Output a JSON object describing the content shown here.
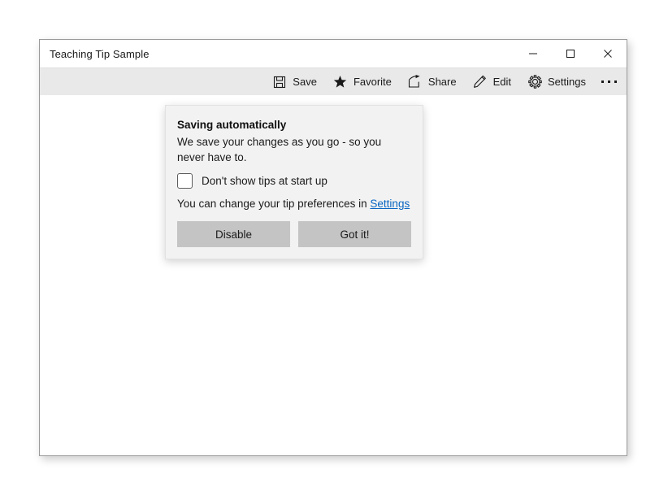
{
  "window": {
    "title": "Teaching Tip Sample",
    "controls": [
      {
        "name": "minimize-button",
        "icon": "minimize-icon"
      },
      {
        "name": "maximize-button",
        "icon": "maximize-icon"
      },
      {
        "name": "close-button",
        "icon": "close-icon"
      }
    ]
  },
  "command_bar": {
    "items": [
      {
        "label": "Save",
        "icon": "save-icon"
      },
      {
        "label": "Favorite",
        "icon": "star-icon"
      },
      {
        "label": "Share",
        "icon": "share-icon"
      },
      {
        "label": "Edit",
        "icon": "pencil-icon"
      },
      {
        "label": "Settings",
        "icon": "gear-icon"
      }
    ],
    "overflow_label": "· · ·"
  },
  "teaching_tip": {
    "title": "Saving automatically",
    "subtitle": "We save your changes as you go - so you never have to.",
    "checkbox_label": "Don't show tips at start up",
    "checkbox_checked": false,
    "preference_text": "You can change your tip preferences in ",
    "preference_link": "Settings",
    "buttons": {
      "secondary": "Disable",
      "primary": "Got it!"
    }
  },
  "colors": {
    "command_bar_bg": "#e9e9e9",
    "tip_bg": "#f2f2f2",
    "button_bg": "#c4c4c4",
    "link": "#0a66c2",
    "text": "#1a1a1a"
  }
}
